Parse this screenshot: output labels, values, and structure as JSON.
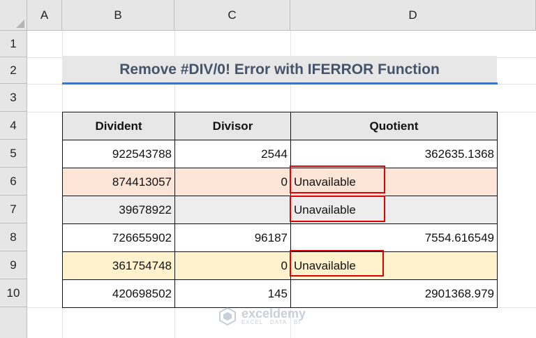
{
  "columns": [
    "A",
    "B",
    "C",
    "D"
  ],
  "rows": [
    "1",
    "2",
    "3",
    "4",
    "5",
    "6",
    "7",
    "8",
    "9",
    "10"
  ],
  "title": "Remove #DIV/0! Error with IFERROR Function",
  "table": {
    "headers": [
      "Divident",
      "Divisor",
      "Quotient"
    ],
    "rows": [
      [
        "922543788",
        "2544",
        "362635.1368"
      ],
      [
        "874413057",
        "0",
        "Unavailable"
      ],
      [
        "39678922",
        "",
        "Unavailable"
      ],
      [
        "726655902",
        "96187",
        "7554.616549"
      ],
      [
        "361754748",
        "0",
        "Unavailable"
      ],
      [
        "420698502",
        "145",
        "2901368.979"
      ]
    ]
  },
  "colors": {
    "title_text": "#44546a",
    "title_underline": "#4472c4",
    "row6_fill": "#fce4d6",
    "row7_fill": "#ededed",
    "row9_fill": "#fff2cc",
    "error_highlight": "#e00000"
  },
  "watermark": {
    "name": "exceldemy",
    "tagline": "EXCEL · DATA · BI",
    "icon": "exceldemy-logo-icon"
  }
}
